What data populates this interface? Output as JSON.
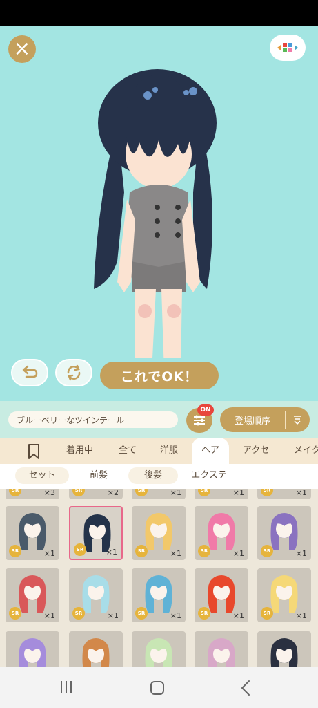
{
  "colors": {
    "stage": "#a3e5e2",
    "gold": "#c4a05c",
    "badge": "#e8463c",
    "sr": "#e6b43c",
    "selected": "#e8688a"
  },
  "top": {
    "close_icon": "close-icon",
    "layout_icon": "color-layout-icon"
  },
  "actions": {
    "undo_icon": "undo-icon",
    "rotate_icon": "rotate-icon",
    "ok_label": "これでOK！"
  },
  "filter_bar": {
    "item_name": "ブルーベリーなツインテール",
    "filter_badge": "ON",
    "sort_label": "登場順序"
  },
  "tabs": [
    "着用中",
    "全て",
    "洋服",
    "ヘア",
    "アクセ",
    "メイク"
  ],
  "active_tab": "ヘア",
  "subtabs": [
    "セット",
    "前髪",
    "後髪",
    "エクステ"
  ],
  "grid": {
    "rarity": "SR",
    "partial_row_counts": [
      "×3",
      "×2",
      "×1",
      "×1",
      "×1"
    ],
    "rows": [
      [
        {
          "count": "×1",
          "hair": "#4a5a6a",
          "tint": "#ccc6bb"
        },
        {
          "count": "×1",
          "hair": "#24334a",
          "tint": "#d8d2c8",
          "selected": true
        },
        {
          "count": "×1",
          "hair": "#f2c86a",
          "tint": "#ccc6bb"
        },
        {
          "count": "×1",
          "hair": "#f07aa8",
          "tint": "#ccc6bb"
        },
        {
          "count": "×1",
          "hair": "#8a72c0",
          "tint": "#ccc6bb"
        }
      ],
      [
        {
          "count": "×1",
          "hair": "#d9585a",
          "tint": "#ccc6bb"
        },
        {
          "count": "×1",
          "hair": "#a8dde8",
          "tint": "#ccc6bb"
        },
        {
          "count": "×1",
          "hair": "#5fb2d6",
          "tint": "#ccc6bb"
        },
        {
          "count": "×1",
          "hair": "#e8482c",
          "tint": "#ccc6bb"
        },
        {
          "count": "×1",
          "hair": "#f5d878",
          "tint": "#ccc6bb"
        }
      ],
      [
        {
          "count": "",
          "hair": "#a58cdc",
          "tint": "#ccc6bb"
        },
        {
          "count": "",
          "hair": "#d2884a",
          "tint": "#ccc6bb"
        },
        {
          "count": "",
          "hair": "#c8e6b4",
          "tint": "#ccc6bb"
        },
        {
          "count": "",
          "hair": "#d8a8c8",
          "tint": "#ccc6bb"
        },
        {
          "count": "",
          "hair": "#2a3040",
          "tint": "#ccc6bb"
        }
      ]
    ]
  }
}
